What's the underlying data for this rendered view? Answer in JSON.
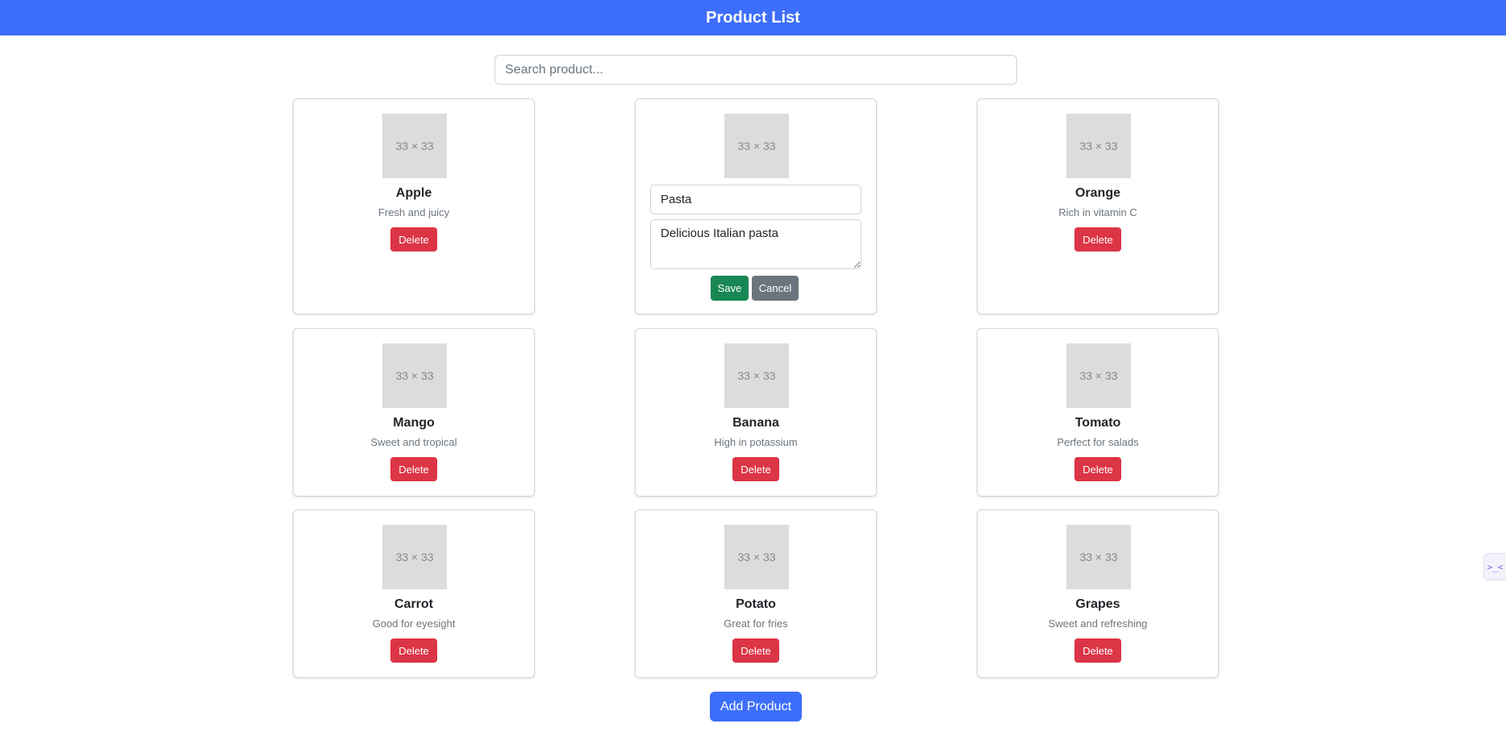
{
  "header": {
    "title": "Product List",
    "background": "#3d6efb"
  },
  "search": {
    "placeholder": "Search product...",
    "value": ""
  },
  "thumbnail_label": "33 × 33",
  "products": [
    {
      "name": "Apple",
      "description": "Fresh and juicy",
      "delete_label": "Delete"
    },
    {
      "name": "Pasta",
      "description": "Delicious Italian pasta",
      "editing": true,
      "save_label": "Save",
      "cancel_label": "Cancel"
    },
    {
      "name": "Orange",
      "description": "Rich in vitamin C",
      "delete_label": "Delete"
    },
    {
      "name": "Mango",
      "description": "Sweet and tropical",
      "delete_label": "Delete"
    },
    {
      "name": "Banana",
      "description": "High in potassium",
      "delete_label": "Delete"
    },
    {
      "name": "Tomato",
      "description": "Perfect for salads",
      "delete_label": "Delete"
    },
    {
      "name": "Carrot",
      "description": "Good for eyesight",
      "delete_label": "Delete"
    },
    {
      "name": "Potato",
      "description": "Great for fries",
      "delete_label": "Delete"
    },
    {
      "name": "Grapes",
      "description": "Sweet and refreshing",
      "delete_label": "Delete"
    }
  ],
  "add_button": {
    "label": "Add Product"
  },
  "side_widget": {
    "icon": "terminal-icon",
    "glyph": ">_<"
  },
  "colors": {
    "primary": "#3d6efb",
    "danger": "#dc3545",
    "success": "#198754",
    "secondary": "#6c757d"
  }
}
